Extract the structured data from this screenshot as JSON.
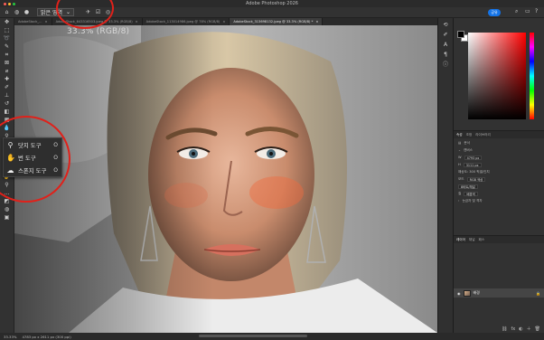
{
  "window": {
    "title": "Adobe Photoshop 2026"
  },
  "options_bar": {
    "range_label": "밝은 영역",
    "share_label": "공유"
  },
  "doc_tabs": [
    {
      "label": "AdobeStock_..."
    },
    {
      "label": "AdobeStock_643316503.jpeg @ 33.3% (RGB/8)"
    },
    {
      "label": "AdobeStock_113014986.jpeg @ 78% (RGB/8)"
    },
    {
      "label": "AdobeStock_313698132.jpeg @ 33.3% (RGB/8) *",
      "active": true
    }
  ],
  "canvas": {
    "zoom_overlay": "33.3% (RGB/8)"
  },
  "flyout": {
    "items": [
      {
        "label": "닷지 도구",
        "shortcut": "O",
        "icon": "dodge-icon"
      },
      {
        "label": "번 도구",
        "shortcut": "O",
        "icon": "burn-icon"
      },
      {
        "label": "스폰지 도구",
        "shortcut": "O",
        "icon": "sponge-icon"
      }
    ]
  },
  "status": {
    "zoom": "33.33%",
    "doc_info": "4783 px x 2611 px (300 ppi)"
  },
  "properties": {
    "tabs": [
      "속성",
      "조정",
      "라이브러리"
    ],
    "doc_label": "문서",
    "canvas_label": "캔버스",
    "width": "4793 px",
    "height": "3111 px",
    "resolution_label": "해상도: 300 픽셀/인치",
    "mode_label": "모드",
    "mode_value": "RGB 색상",
    "depth_value": "8비트/채널",
    "fill_label": "칠",
    "fill_value": "배경색",
    "rulers_label": "눈금자 및 격자"
  },
  "layers": {
    "tabs": [
      "레이어",
      "채널",
      "패스"
    ],
    "background_layer": "배경"
  },
  "colors": {
    "highlight_circle": "#e0211a",
    "accent": "#1473e6",
    "close": "#ff5f57",
    "minimize": "#febc2e",
    "zoom": "#28c840"
  }
}
